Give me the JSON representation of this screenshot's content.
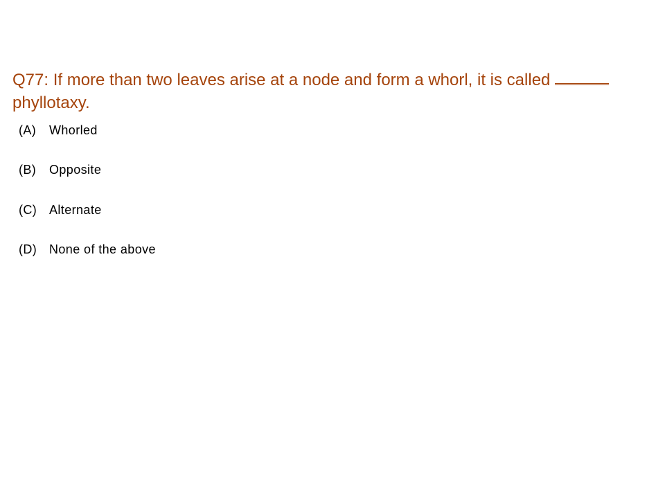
{
  "question": {
    "prefix": "Q77: If more than two leaves arise at a node and form a whorl, it is called",
    "suffix": "phyllotaxy."
  },
  "options": [
    {
      "letter": "(A)",
      "text": "Whorled"
    },
    {
      "letter": "(B)",
      "text": "Opposite"
    },
    {
      "letter": "(C)",
      "text": "Alternate"
    },
    {
      "letter": "(D)",
      "text": "None of the above"
    }
  ],
  "colors": {
    "question": "#a5440c",
    "options": "#000000",
    "background": "#ffffff"
  }
}
